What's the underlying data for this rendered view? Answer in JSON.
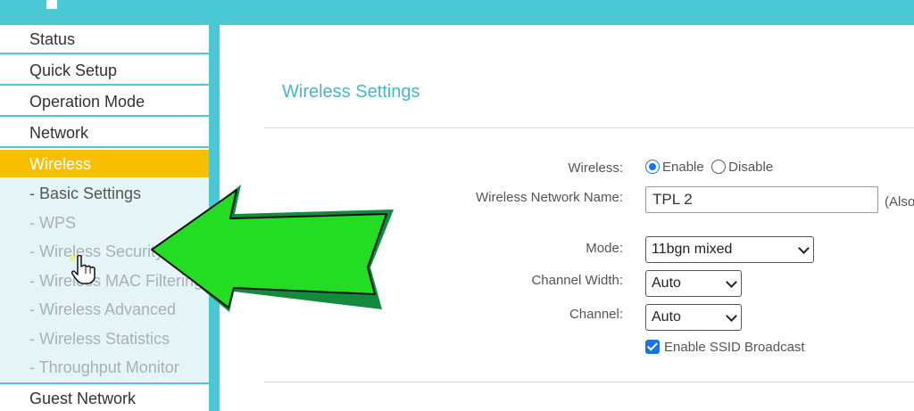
{
  "sidebar": {
    "items": [
      {
        "label": "Status"
      },
      {
        "label": "Quick Setup"
      },
      {
        "label": "Operation Mode"
      },
      {
        "label": "Network"
      },
      {
        "label": "Wireless"
      },
      {
        "label": "Guest Network"
      }
    ],
    "submenu": [
      {
        "label": "- Basic Settings"
      },
      {
        "label": "- WPS"
      },
      {
        "label": "- Wireless Security"
      },
      {
        "label": "- Wireless MAC Filtering"
      },
      {
        "label": "- Wireless Advanced"
      },
      {
        "label": "- Wireless Statistics"
      },
      {
        "label": "- Throughput Monitor"
      }
    ]
  },
  "main": {
    "title": "Wireless Settings",
    "wireless": {
      "label": "Wireless:",
      "enable": "Enable",
      "disable": "Disable",
      "selected": "Enable"
    },
    "network_name": {
      "label": "Wireless Network Name:",
      "value": "TPL 2",
      "note": "(Also"
    },
    "mode": {
      "label": "Mode:",
      "value": "11bgn mixed"
    },
    "channel_width": {
      "label": "Channel Width:",
      "value": "Auto"
    },
    "channel": {
      "label": "Channel:",
      "value": "Auto"
    },
    "ssid_broadcast": {
      "label": "Enable SSID Broadcast",
      "checked": true
    }
  },
  "colors": {
    "brand": "#4ac8d4",
    "active_menu": "#f7c000",
    "arrow": "#22dd22"
  },
  "icons": {
    "arrow": "green-left-arrow-icon",
    "cursor": "hand-pointer-icon"
  }
}
